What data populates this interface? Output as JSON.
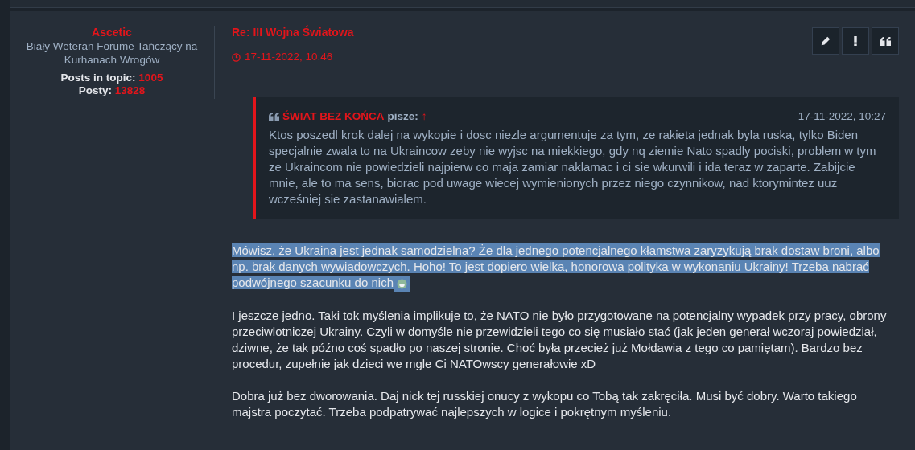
{
  "author": {
    "name": "Ascetic",
    "rank": "Biały Weteran Forume Tańczący na Kurhanach Wrogów",
    "stats": [
      {
        "label": "Posts in topic:",
        "value": "1005"
      },
      {
        "label": "Posty:",
        "value": "13828"
      }
    ]
  },
  "post": {
    "title": "Re: III Wojna Światowa",
    "date": "17-11-2022, 10:46",
    "actions": [
      {
        "kind": "edit"
      },
      {
        "kind": "report"
      },
      {
        "kind": "quote"
      }
    ],
    "quote": {
      "author": "ŚWIAT BEZ KOŃCA",
      "verb": "pisze:",
      "arrow": "↑",
      "date": "17-11-2022, 10:27",
      "text": "Ktos poszedl krok dalej na wykopie i dosc niezle argumentuje za tym, ze rakieta jednak byla ruska, tylko Biden specjalnie zwala to na Ukraincow zeby nie wyjsc na miekkiego, gdy nq ziemie Nato spadly pociski, problem w tym ze Ukraincom nie powiedzieli najpierw co maja zamiar naklamac i ci sie wkurwili i ida teraz w zaparte. Zabijcie mnie, ale to ma sens, biorac pod uwage wiecej wymienionych przez niego czynnikow, nad ktorymintez uuz wcześniej sie zastanawialem."
    },
    "paragraphs": [
      {
        "text": "Mówisz, że Ukraina jest jednak samodzielna? Że dla jednego potencjalnego kłamstwa zaryzykują brak dostaw broni, albo np. brak danych wywiadowczych. Hoho! To jest dopiero wielka, honorowa polityka w wykonaniu Ukrainy! Trzeba nabrać podwójnego szacunku do nich",
        "emoji": true,
        "selected": true
      },
      {
        "text": "I jeszcze jedno. Taki tok myślenia implikuje to, że NATO nie było przygotowane na potencjalny wypadek przy pracy, obrony przeciwlotniczej Ukrainy. Czyli w domyśle nie przewidzieli tego co się musiało stać (jak jeden generał wczoraj powiedział, dziwne, że tak późno coś spadło po naszej stronie. Choć była przecież już Mołdawia z tego co pamiętam). Bardzo bez procedur, zupełnie jak dzieci we mgle Ci NATOwscy generałowie xD",
        "emoji": false,
        "selected": false
      },
      {
        "text": "Dobra już bez dworowania. Daj nick tej russkiej onucy z wykopu co Tobą tak zakręciła. Musi być dobry. Warto takiego majstra poczytać. Trzeba podpatrywać najlepszych w logice i pokrętnym myśleniu.",
        "emoji": false,
        "selected": false
      }
    ]
  }
}
